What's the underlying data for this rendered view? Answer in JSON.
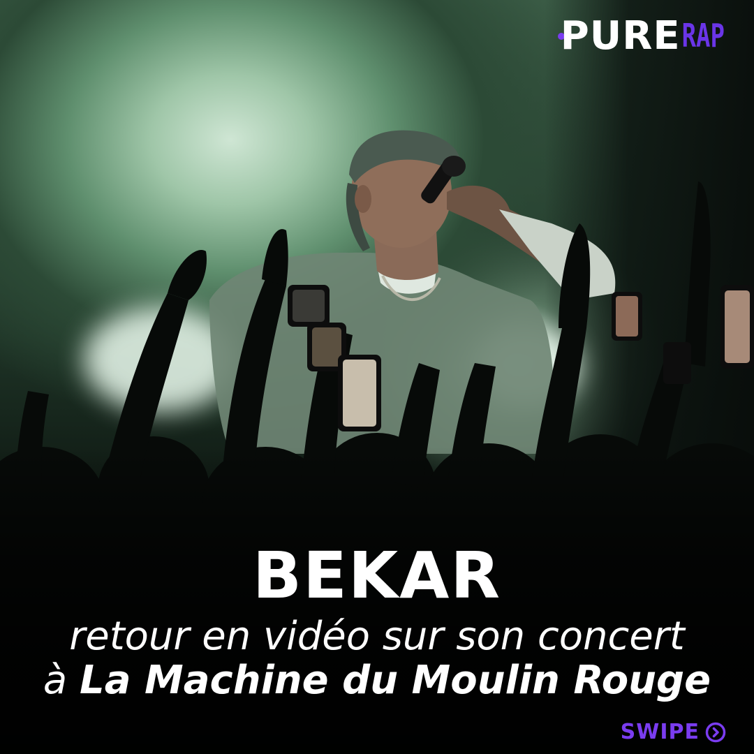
{
  "brand": {
    "logo_main": "PURE",
    "logo_suffix": "RAP",
    "accent_color": "#7a3cf0"
  },
  "post": {
    "artist": "BEKAR",
    "subtitle_line1": "retour en vidéo sur son concert",
    "subtitle_line2_prefix": "à ",
    "subtitle_line2_venue": "La Machine du Moulin Rouge"
  },
  "cta": {
    "label": "SWIPE",
    "icon": "chevron-right-circle-icon"
  }
}
